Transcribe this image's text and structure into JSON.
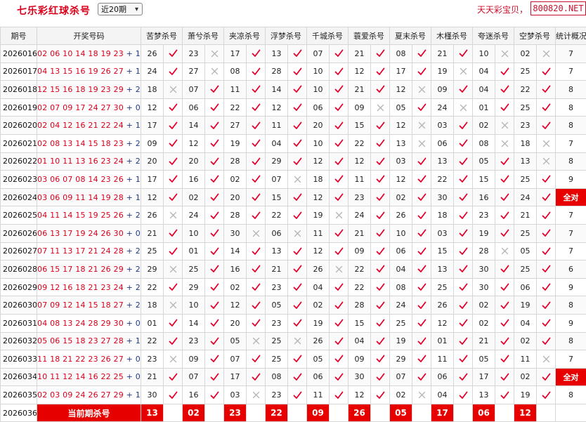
{
  "header": {
    "title": "七乐彩红球杀号",
    "range_select": "近20期",
    "brand_text": "天天彩宝贝，",
    "site_badge": "800820.NET"
  },
  "table": {
    "headers": [
      "期号",
      "开奖号码",
      "苦梦杀号",
      "萧兮杀号",
      "夹凉杀号",
      "浮梦杀号",
      "千城杀号",
      "蓑爱杀号",
      "夏末杀号",
      "木槿杀号",
      "夸迷杀号",
      "空梦杀号",
      "统计概况"
    ],
    "rows": [
      {
        "period": "2026016",
        "main": "02 06 10 14 18 19 23",
        "plus": "+",
        "special": "11",
        "predictions": [
          [
            "26",
            true
          ],
          [
            "23",
            false
          ],
          [
            "17",
            true
          ],
          [
            "13",
            true
          ],
          [
            "07",
            true
          ],
          [
            "21",
            true
          ],
          [
            "08",
            true
          ],
          [
            "21",
            true
          ],
          [
            "10",
            false
          ],
          [
            "02",
            false
          ]
        ],
        "stat": "7"
      },
      {
        "period": "2026017",
        "main": "04 13 15 16 19 26 27",
        "plus": "+",
        "special": "18",
        "predictions": [
          [
            "24",
            true
          ],
          [
            "27",
            false
          ],
          [
            "08",
            true
          ],
          [
            "28",
            true
          ],
          [
            "10",
            true
          ],
          [
            "12",
            true
          ],
          [
            "17",
            true
          ],
          [
            "19",
            false
          ],
          [
            "04",
            true
          ],
          [
            "25",
            true
          ]
        ],
        "stat": "7"
      },
      {
        "period": "2026018",
        "main": "12 15 16 18 19 23 29",
        "plus": "+",
        "special": "26",
        "predictions": [
          [
            "18",
            false
          ],
          [
            "07",
            true
          ],
          [
            "11",
            true
          ],
          [
            "14",
            true
          ],
          [
            "10",
            true
          ],
          [
            "21",
            true
          ],
          [
            "12",
            false
          ],
          [
            "09",
            true
          ],
          [
            "04",
            true
          ],
          [
            "22",
            true
          ]
        ],
        "stat": "8"
      },
      {
        "period": "2026019",
        "main": "02 07 09 17 24 27 30",
        "plus": "+",
        "special": "08",
        "predictions": [
          [
            "12",
            true
          ],
          [
            "06",
            true
          ],
          [
            "22",
            true
          ],
          [
            "12",
            true
          ],
          [
            "06",
            true
          ],
          [
            "09",
            false
          ],
          [
            "05",
            true
          ],
          [
            "24",
            false
          ],
          [
            "01",
            true
          ],
          [
            "25",
            true
          ]
        ],
        "stat": "8"
      },
      {
        "period": "2026020",
        "main": "02 04 12 16 21 22 24",
        "plus": "+",
        "special": "11",
        "predictions": [
          [
            "17",
            true
          ],
          [
            "14",
            true
          ],
          [
            "27",
            true
          ],
          [
            "11",
            true
          ],
          [
            "20",
            true
          ],
          [
            "15",
            true
          ],
          [
            "12",
            false
          ],
          [
            "03",
            true
          ],
          [
            "02",
            false
          ],
          [
            "23",
            true
          ]
        ],
        "stat": "8"
      },
      {
        "period": "2026021",
        "main": "02 08 13 14 15 18 23",
        "plus": "+",
        "special": "24",
        "predictions": [
          [
            "09",
            true
          ],
          [
            "12",
            true
          ],
          [
            "19",
            true
          ],
          [
            "04",
            true
          ],
          [
            "10",
            true
          ],
          [
            "22",
            true
          ],
          [
            "13",
            false
          ],
          [
            "06",
            true
          ],
          [
            "08",
            false
          ],
          [
            "18",
            false
          ]
        ],
        "stat": "7"
      },
      {
        "period": "2026022",
        "main": "01 10 11 13 16 23 24",
        "plus": "+",
        "special": "29",
        "predictions": [
          [
            "20",
            true
          ],
          [
            "20",
            true
          ],
          [
            "28",
            true
          ],
          [
            "29",
            true
          ],
          [
            "12",
            true
          ],
          [
            "12",
            true
          ],
          [
            "03",
            true
          ],
          [
            "13",
            true
          ],
          [
            "05",
            true
          ],
          [
            "13",
            false
          ]
        ],
        "stat": "8"
      },
      {
        "period": "2026023",
        "main": "03 06 07 08 14 23 26",
        "plus": "+",
        "special": "13",
        "predictions": [
          [
            "17",
            true
          ],
          [
            "16",
            true
          ],
          [
            "02",
            true
          ],
          [
            "07",
            false
          ],
          [
            "18",
            true
          ],
          [
            "11",
            true
          ],
          [
            "12",
            true
          ],
          [
            "22",
            true
          ],
          [
            "15",
            true
          ],
          [
            "25",
            true
          ]
        ],
        "stat": "9"
      },
      {
        "period": "2026024",
        "main": "03 06 09 11 14 19 28",
        "plus": "+",
        "special": "16",
        "predictions": [
          [
            "12",
            true
          ],
          [
            "02",
            true
          ],
          [
            "20",
            true
          ],
          [
            "15",
            true
          ],
          [
            "12",
            true
          ],
          [
            "23",
            true
          ],
          [
            "02",
            true
          ],
          [
            "30",
            true
          ],
          [
            "16",
            true
          ],
          [
            "24",
            true
          ]
        ],
        "stat": "全对"
      },
      {
        "period": "2026025",
        "main": "04 11 14 15 19 25 26",
        "plus": "+",
        "special": "21",
        "predictions": [
          [
            "26",
            false
          ],
          [
            "24",
            true
          ],
          [
            "28",
            true
          ],
          [
            "22",
            true
          ],
          [
            "19",
            false
          ],
          [
            "24",
            true
          ],
          [
            "26",
            true
          ],
          [
            "18",
            true
          ],
          [
            "23",
            true
          ],
          [
            "21",
            true
          ]
        ],
        "stat": "7"
      },
      {
        "period": "2026026",
        "main": "06 13 17 19 24 26 30",
        "plus": "+",
        "special": "02",
        "predictions": [
          [
            "21",
            true
          ],
          [
            "10",
            true
          ],
          [
            "30",
            false
          ],
          [
            "06",
            false
          ],
          [
            "11",
            true
          ],
          [
            "21",
            true
          ],
          [
            "10",
            true
          ],
          [
            "03",
            true
          ],
          [
            "19",
            true
          ],
          [
            "25",
            true
          ]
        ],
        "stat": "7"
      },
      {
        "period": "2026027",
        "main": "07 11 13 17 21 24 28",
        "plus": "+",
        "special": "25",
        "predictions": [
          [
            "25",
            true
          ],
          [
            "01",
            true
          ],
          [
            "14",
            true
          ],
          [
            "13",
            true
          ],
          [
            "12",
            true
          ],
          [
            "09",
            true
          ],
          [
            "06",
            true
          ],
          [
            "15",
            true
          ],
          [
            "28",
            false
          ],
          [
            "05",
            true
          ]
        ],
        "stat": "7"
      },
      {
        "period": "2026028",
        "main": "06 15 17 18 21 26 29",
        "plus": "+",
        "special": "24",
        "predictions": [
          [
            "29",
            false
          ],
          [
            "25",
            true
          ],
          [
            "16",
            true
          ],
          [
            "21",
            true
          ],
          [
            "26",
            false
          ],
          [
            "22",
            true
          ],
          [
            "04",
            true
          ],
          [
            "13",
            true
          ],
          [
            "30",
            true
          ],
          [
            "25",
            true
          ]
        ],
        "stat": "6"
      },
      {
        "period": "2026029",
        "main": "09 12 16 18 21 23 24",
        "plus": "+",
        "special": "26",
        "predictions": [
          [
            "22",
            true
          ],
          [
            "29",
            true
          ],
          [
            "02",
            true
          ],
          [
            "23",
            true
          ],
          [
            "04",
            true
          ],
          [
            "22",
            true
          ],
          [
            "08",
            true
          ],
          [
            "25",
            true
          ],
          [
            "30",
            true
          ],
          [
            "06",
            true
          ]
        ],
        "stat": "9"
      },
      {
        "period": "2026030",
        "main": "07 09 12 14 15 18 27",
        "plus": "+",
        "special": "28",
        "predictions": [
          [
            "18",
            false
          ],
          [
            "10",
            true
          ],
          [
            "12",
            true
          ],
          [
            "05",
            true
          ],
          [
            "02",
            true
          ],
          [
            "28",
            true
          ],
          [
            "24",
            true
          ],
          [
            "26",
            true
          ],
          [
            "02",
            true
          ],
          [
            "19",
            true
          ]
        ],
        "stat": "8"
      },
      {
        "period": "2026031",
        "main": "04 08 13 24 28 29 30",
        "plus": "+",
        "special": "09",
        "predictions": [
          [
            "01",
            true
          ],
          [
            "14",
            true
          ],
          [
            "20",
            true
          ],
          [
            "23",
            true
          ],
          [
            "19",
            true
          ],
          [
            "15",
            true
          ],
          [
            "25",
            true
          ],
          [
            "12",
            true
          ],
          [
            "02",
            true
          ],
          [
            "04",
            true
          ]
        ],
        "stat": "9"
      },
      {
        "period": "2026032",
        "main": "05 06 15 18 23 27 28",
        "plus": "+",
        "special": "19",
        "predictions": [
          [
            "22",
            true
          ],
          [
            "23",
            true
          ],
          [
            "05",
            false
          ],
          [
            "25",
            false
          ],
          [
            "26",
            true
          ],
          [
            "04",
            true
          ],
          [
            "19",
            true
          ],
          [
            "01",
            true
          ],
          [
            "21",
            true
          ],
          [
            "02",
            true
          ]
        ],
        "stat": "8"
      },
      {
        "period": "2026033",
        "main": "11 18 21 22 23 26 27",
        "plus": "+",
        "special": "02",
        "predictions": [
          [
            "23",
            false
          ],
          [
            "09",
            true
          ],
          [
            "07",
            true
          ],
          [
            "25",
            true
          ],
          [
            "05",
            true
          ],
          [
            "09",
            true
          ],
          [
            "29",
            true
          ],
          [
            "11",
            true
          ],
          [
            "05",
            true
          ],
          [
            "11",
            false
          ]
        ],
        "stat": "7"
      },
      {
        "period": "2026034",
        "main": "10 11 12 14 16 22 25",
        "plus": "+",
        "special": "04",
        "predictions": [
          [
            "21",
            true
          ],
          [
            "07",
            true
          ],
          [
            "17",
            true
          ],
          [
            "08",
            true
          ],
          [
            "06",
            true
          ],
          [
            "30",
            true
          ],
          [
            "07",
            true
          ],
          [
            "06",
            true
          ],
          [
            "17",
            true
          ],
          [
            "02",
            true
          ]
        ],
        "stat": "全对"
      },
      {
        "period": "2026035",
        "main": "02 03 09 24 26 27 29",
        "plus": "+",
        "special": "14",
        "predictions": [
          [
            "30",
            true
          ],
          [
            "16",
            true
          ],
          [
            "03",
            false
          ],
          [
            "23",
            true
          ],
          [
            "11",
            true
          ],
          [
            "12",
            true
          ],
          [
            "02",
            false
          ],
          [
            "04",
            true
          ],
          [
            "13",
            true
          ],
          [
            "19",
            true
          ]
        ],
        "stat": "8"
      }
    ],
    "current": {
      "period": "2026036",
      "label": "当前期杀号",
      "numbers": [
        "13",
        "02",
        "23",
        "22",
        "09",
        "26",
        "05",
        "17",
        "06",
        "12"
      ]
    }
  },
  "colors": {
    "accent_red": "#e60000",
    "check_red": "#e4002b",
    "cross_gray": "#b5b5b5",
    "special_blue": "#1e3a8a"
  }
}
